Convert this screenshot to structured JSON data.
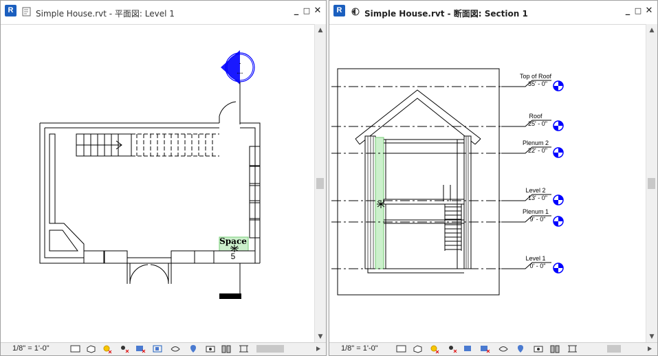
{
  "left_view": {
    "title": "Simple House.rvt - 平面図: Level 1",
    "app_icon_label": "R",
    "minimize": "_",
    "restore": "□",
    "close": "✕",
    "scale": "1/8\" = 1'-0\"",
    "space_label": "Space",
    "space_number": "5",
    "elevation_marker_top": "-",
    "elevation_marker_bottom": "---"
  },
  "right_view": {
    "title": "Simple House.rvt - 断面図: Section 1",
    "app_icon_label": "R",
    "minimize": "_",
    "restore": "□",
    "close": "✕",
    "scale": "1/8\" = 1'-0\"",
    "levels": [
      {
        "name": "Top of Roof",
        "elevation": "35' - 0\""
      },
      {
        "name": "Roof",
        "elevation": "25' - 0\""
      },
      {
        "name": "Plenum 2",
        "elevation": "22' - 0\""
      },
      {
        "name": "Level 2",
        "elevation": "13' - 0\""
      },
      {
        "name": "Plenum 1",
        "elevation": "9' - 0\""
      },
      {
        "name": "Level 1",
        "elevation": "0' - 0\""
      }
    ]
  },
  "scrollbar": {
    "up": "▲",
    "down": "▼"
  },
  "status_icons": [
    "detail-level-icon",
    "visual-style-icon",
    "sun-path-icon",
    "shadows-icon",
    "crop-view-icon",
    "show-crop-icon",
    "unlock-3d-icon",
    "temporary-hide-icon",
    "reveal-hidden-icon",
    "temporary-view-icon",
    "worksharing-display-icon",
    "analytical-model-icon",
    "highlight-displacement-icon"
  ],
  "colors": {
    "accent_blue": "#1b5fbf",
    "marker_blue": "#0000ff",
    "space_fill": "#ccf0cc"
  }
}
